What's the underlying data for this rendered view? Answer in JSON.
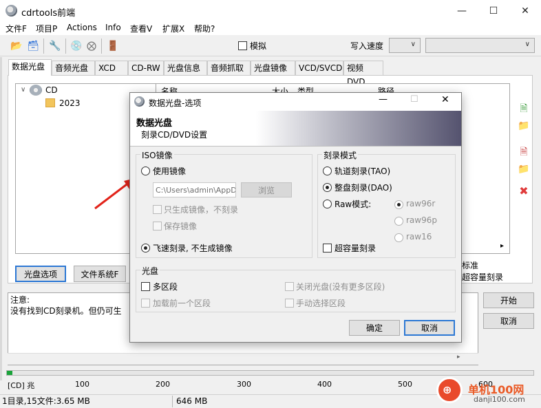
{
  "window": {
    "title": "cdrtools前端"
  },
  "menu": [
    "文件F",
    "项目P",
    "Actions",
    "Info",
    "查看V",
    "扩展X",
    "帮助?"
  ],
  "toolbar": {
    "simulate_label": "模拟",
    "write_speed_label": "写入速度"
  },
  "tabs": [
    "数据光盘",
    "音频光盘",
    "XCD",
    "CD-RW",
    "光盘信息",
    "音频抓取",
    "光盘镜像",
    "VCD/SVCD",
    "视频DVD"
  ],
  "tree": {
    "root": "CD",
    "child": "2023"
  },
  "file_columns": [
    "名称",
    "大小",
    "类型",
    "路径"
  ],
  "main_buttons": {
    "disc_options": "光盘选项",
    "file_system": "文件系统F"
  },
  "right_options": {
    "standard": "标准",
    "overburn": "超容量刻录"
  },
  "log": {
    "title": "注意:",
    "text": "没有找到CD刻录机。但仍可生"
  },
  "actions": {
    "start": "开始",
    "cancel": "取消"
  },
  "progress": {
    "unit_label": "[CD] 兆",
    "ticks": [
      "100",
      "200",
      "300",
      "400",
      "500",
      "600"
    ]
  },
  "status": {
    "files": "1目录,15文件:3.65 MB",
    "size": "646 MB"
  },
  "watermark": {
    "site": "单机100网",
    "url": "danji100.com"
  },
  "dialog": {
    "title": "数据光盘-选项",
    "header_title": "数据光盘",
    "header_subtitle": "刻录CD/DVD设置",
    "iso": {
      "group": "ISO镜像",
      "use_image": "使用镜像",
      "path": "C:\\Users\\admin\\AppD",
      "browse": "浏览",
      "only_image": "只生成镜像，不刻录",
      "keep_image": "保存镜像",
      "on_the_fly": "飞速刻录, 不生成镜像"
    },
    "mode": {
      "group": "刻录模式",
      "tao": "轨道刻录(TAO)",
      "dao": "整盘刻录(DAO)",
      "raw": "Raw模式:",
      "raw96r": "raw96r",
      "raw96p": "raw96p",
      "raw16": "raw16",
      "overburn": "超容量刻录"
    },
    "disc": {
      "group": "光盘",
      "multisession": "多区段",
      "close_disc": "关闭光盘(没有更多区段)",
      "load_previous": "加载前一个区段",
      "manual_select": "手动选择区段"
    },
    "ok": "确定",
    "cancel": "取消"
  }
}
